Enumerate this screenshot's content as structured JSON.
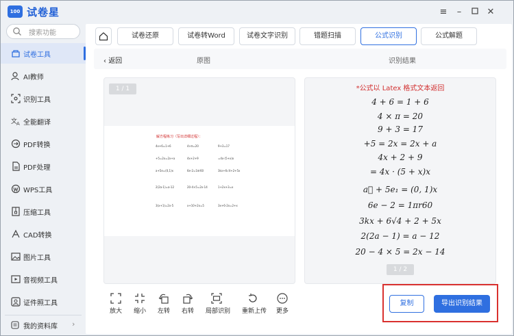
{
  "app": {
    "logo_text": "100",
    "logo_sub": "试卷星",
    "name": "试卷星"
  },
  "search": {
    "placeholder": "搜索功能"
  },
  "sidebar": {
    "items": [
      {
        "label": "试卷工具",
        "icon": "toolbox-icon",
        "active": true
      },
      {
        "label": "AI教师",
        "icon": "ai-teacher-icon"
      },
      {
        "label": "识别工具",
        "icon": "scan-icon"
      },
      {
        "label": "全能翻译",
        "icon": "translate-icon"
      },
      {
        "label": "PDF转换",
        "icon": "pdf-convert-icon"
      },
      {
        "label": "PDF处理",
        "icon": "pdf-process-icon"
      },
      {
        "label": "WPS工具",
        "icon": "wps-icon"
      },
      {
        "label": "压缩工具",
        "icon": "compress-icon"
      },
      {
        "label": "CAD转换",
        "icon": "cad-icon"
      },
      {
        "label": "图片工具",
        "icon": "image-icon"
      },
      {
        "label": "音视频工具",
        "icon": "media-icon"
      },
      {
        "label": "证件照工具",
        "icon": "id-photo-icon"
      }
    ],
    "footer_label": "我的资料库"
  },
  "tabs": [
    "试卷还原",
    "试卷转Word",
    "试卷文字识别",
    "错题扫描",
    "公式识别",
    "公式解题"
  ],
  "active_tab": "公式识别",
  "subheader": {
    "back": "返回",
    "original": "原图",
    "result": "识别结果"
  },
  "original_panel": {
    "page_indicator": "1 / 1",
    "doc_title": "解方程练习（写出详细过程）：",
    "doc_equations": [
      "4x+6=1+6",
      "4×π=20",
      "9+3=17",
      "+5=2x=2x+a",
      "4x+2+9",
      "=4x·(5+x)x",
      "a+5e=(0,1)x",
      "6e-2=1πr60",
      "3kx+6√4+2+5x",
      "2(2a-1)=a-12",
      "20-4×5=2x-14",
      "1+2x+3=x",
      "3(x+1)=2x-5",
      "x+10+2x=5",
      "3x+6-2x=2+x"
    ]
  },
  "result_panel": {
    "note": "*公式以 Latex 格式文本返回",
    "formulas": [
      "4 + 6 = 1 + 6",
      "4 × π = 20",
      "9 + 3 = 17",
      "+5 = 2x = 2x + a",
      "4x + 2 + 9",
      "= 4x · (5 + x)x",
      "a⃗ + 5e₁ = (0, 1)x",
      "6e − 2 = 1πr60",
      "3kx + 6√4 + 2 + 5x",
      "2(2a − 1) = a − 12",
      "20 − 4 × 5 = 2x − 14"
    ],
    "page_indicator": "1 / 2"
  },
  "toolbar": [
    {
      "label": "放大",
      "icon": "zoom-in-icon"
    },
    {
      "label": "缩小",
      "icon": "zoom-out-icon"
    },
    {
      "label": "左转",
      "icon": "rotate-left-icon"
    },
    {
      "label": "右转",
      "icon": "rotate-right-icon"
    },
    {
      "label": "局部识别",
      "icon": "crop-icon"
    },
    {
      "label": "重新上传",
      "icon": "reupload-icon"
    },
    {
      "label": "更多",
      "icon": "more-icon"
    }
  ],
  "actions": {
    "copy": "复制",
    "export": "导出识别结果"
  },
  "colors": {
    "accent": "#2f6fe0",
    "highlight": "#d9302e",
    "note_red": "#d23030"
  }
}
